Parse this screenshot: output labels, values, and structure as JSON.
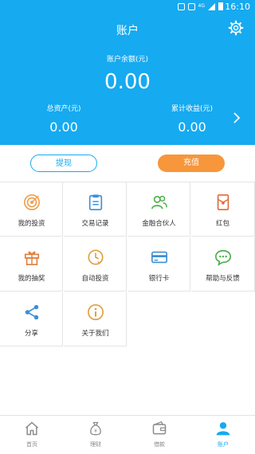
{
  "status_bar": {
    "time": "16:10",
    "network": "4G"
  },
  "header": {
    "title": "账户"
  },
  "summary": {
    "balance_label": "账户余额(元)",
    "balance_value": "0.00",
    "assets_label": "总资产(元)",
    "assets_value": "0.00",
    "income_label": "累计收益(元)",
    "income_value": "0.00"
  },
  "actions": {
    "withdraw": "提现",
    "recharge": "充值"
  },
  "grid": [
    {
      "label": "我的投资",
      "icon": "target-icon"
    },
    {
      "label": "交易记录",
      "icon": "clipboard-icon"
    },
    {
      "label": "金融合伙人",
      "icon": "partners-icon"
    },
    {
      "label": "红包",
      "icon": "red-packet-icon"
    },
    {
      "label": "我的抽奖",
      "icon": "gift-icon"
    },
    {
      "label": "自动投资",
      "icon": "auto-invest-icon"
    },
    {
      "label": "银行卡",
      "icon": "bank-card-icon"
    },
    {
      "label": "帮助与反馈",
      "icon": "chat-bubble-icon"
    },
    {
      "label": "分享",
      "icon": "share-icon"
    },
    {
      "label": "关于我们",
      "icon": "info-icon"
    }
  ],
  "tabs": [
    {
      "label": "首页",
      "icon": "home-icon"
    },
    {
      "label": "理财",
      "icon": "money-bag-icon"
    },
    {
      "label": "借款",
      "icon": "wallet-icon"
    },
    {
      "label": "账户",
      "icon": "person-icon",
      "active": true
    }
  ],
  "colors": {
    "primary": "#16aaf0",
    "accent": "#f7963a"
  }
}
